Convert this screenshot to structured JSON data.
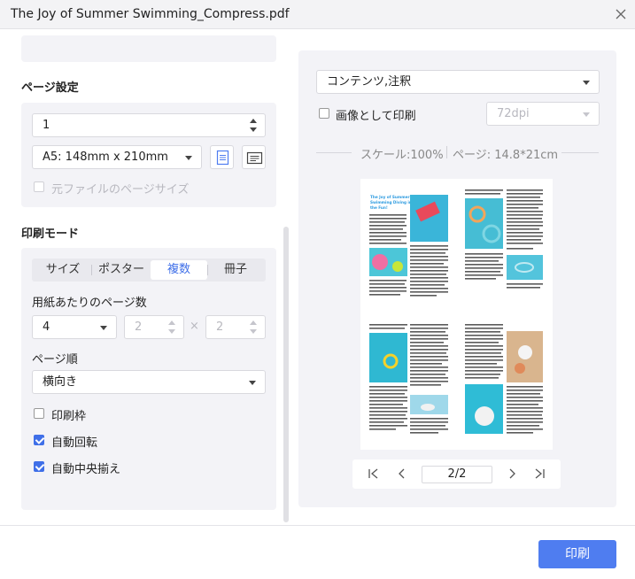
{
  "window": {
    "title": "The Joy of Summer Swimming_Compress.pdf"
  },
  "page_settings": {
    "heading": "ページ設定",
    "copies": "1",
    "paper_size": "A5: 148mm x 210mm",
    "original_size_label": "元ファイルのページサイズ",
    "original_size_checked": false
  },
  "print_mode": {
    "heading": "印刷モード",
    "tabs": [
      "サイズ",
      "ポスター",
      "複数",
      "冊子"
    ],
    "active_tab": "複数",
    "pages_per_sheet_label": "用紙あたりのページ数",
    "pages_per_sheet": "4",
    "cols": "2",
    "times": "×",
    "rows": "2",
    "page_order_label": "ページ順",
    "page_order": "横向き",
    "options": [
      {
        "label": "印刷枠",
        "checked": false
      },
      {
        "label": "自動回転",
        "checked": true
      },
      {
        "label": "自動中央揃え",
        "checked": true
      }
    ]
  },
  "preview": {
    "content_select": "コンテンツ,注釈",
    "print_as_image_label": "画像として印刷",
    "print_as_image_checked": false,
    "dpi": "72dpi",
    "scale_text": "スケール:100%",
    "page_size_text": "ページ: 14.8*21cm",
    "thumb_title": "The Joy of Summer Swimming Dive into the Fun!",
    "current_page": "2/2"
  },
  "footer": {
    "print_label": "印刷"
  },
  "colors": {
    "accent": "#4f7df0",
    "panel": "#f3f3f7"
  }
}
